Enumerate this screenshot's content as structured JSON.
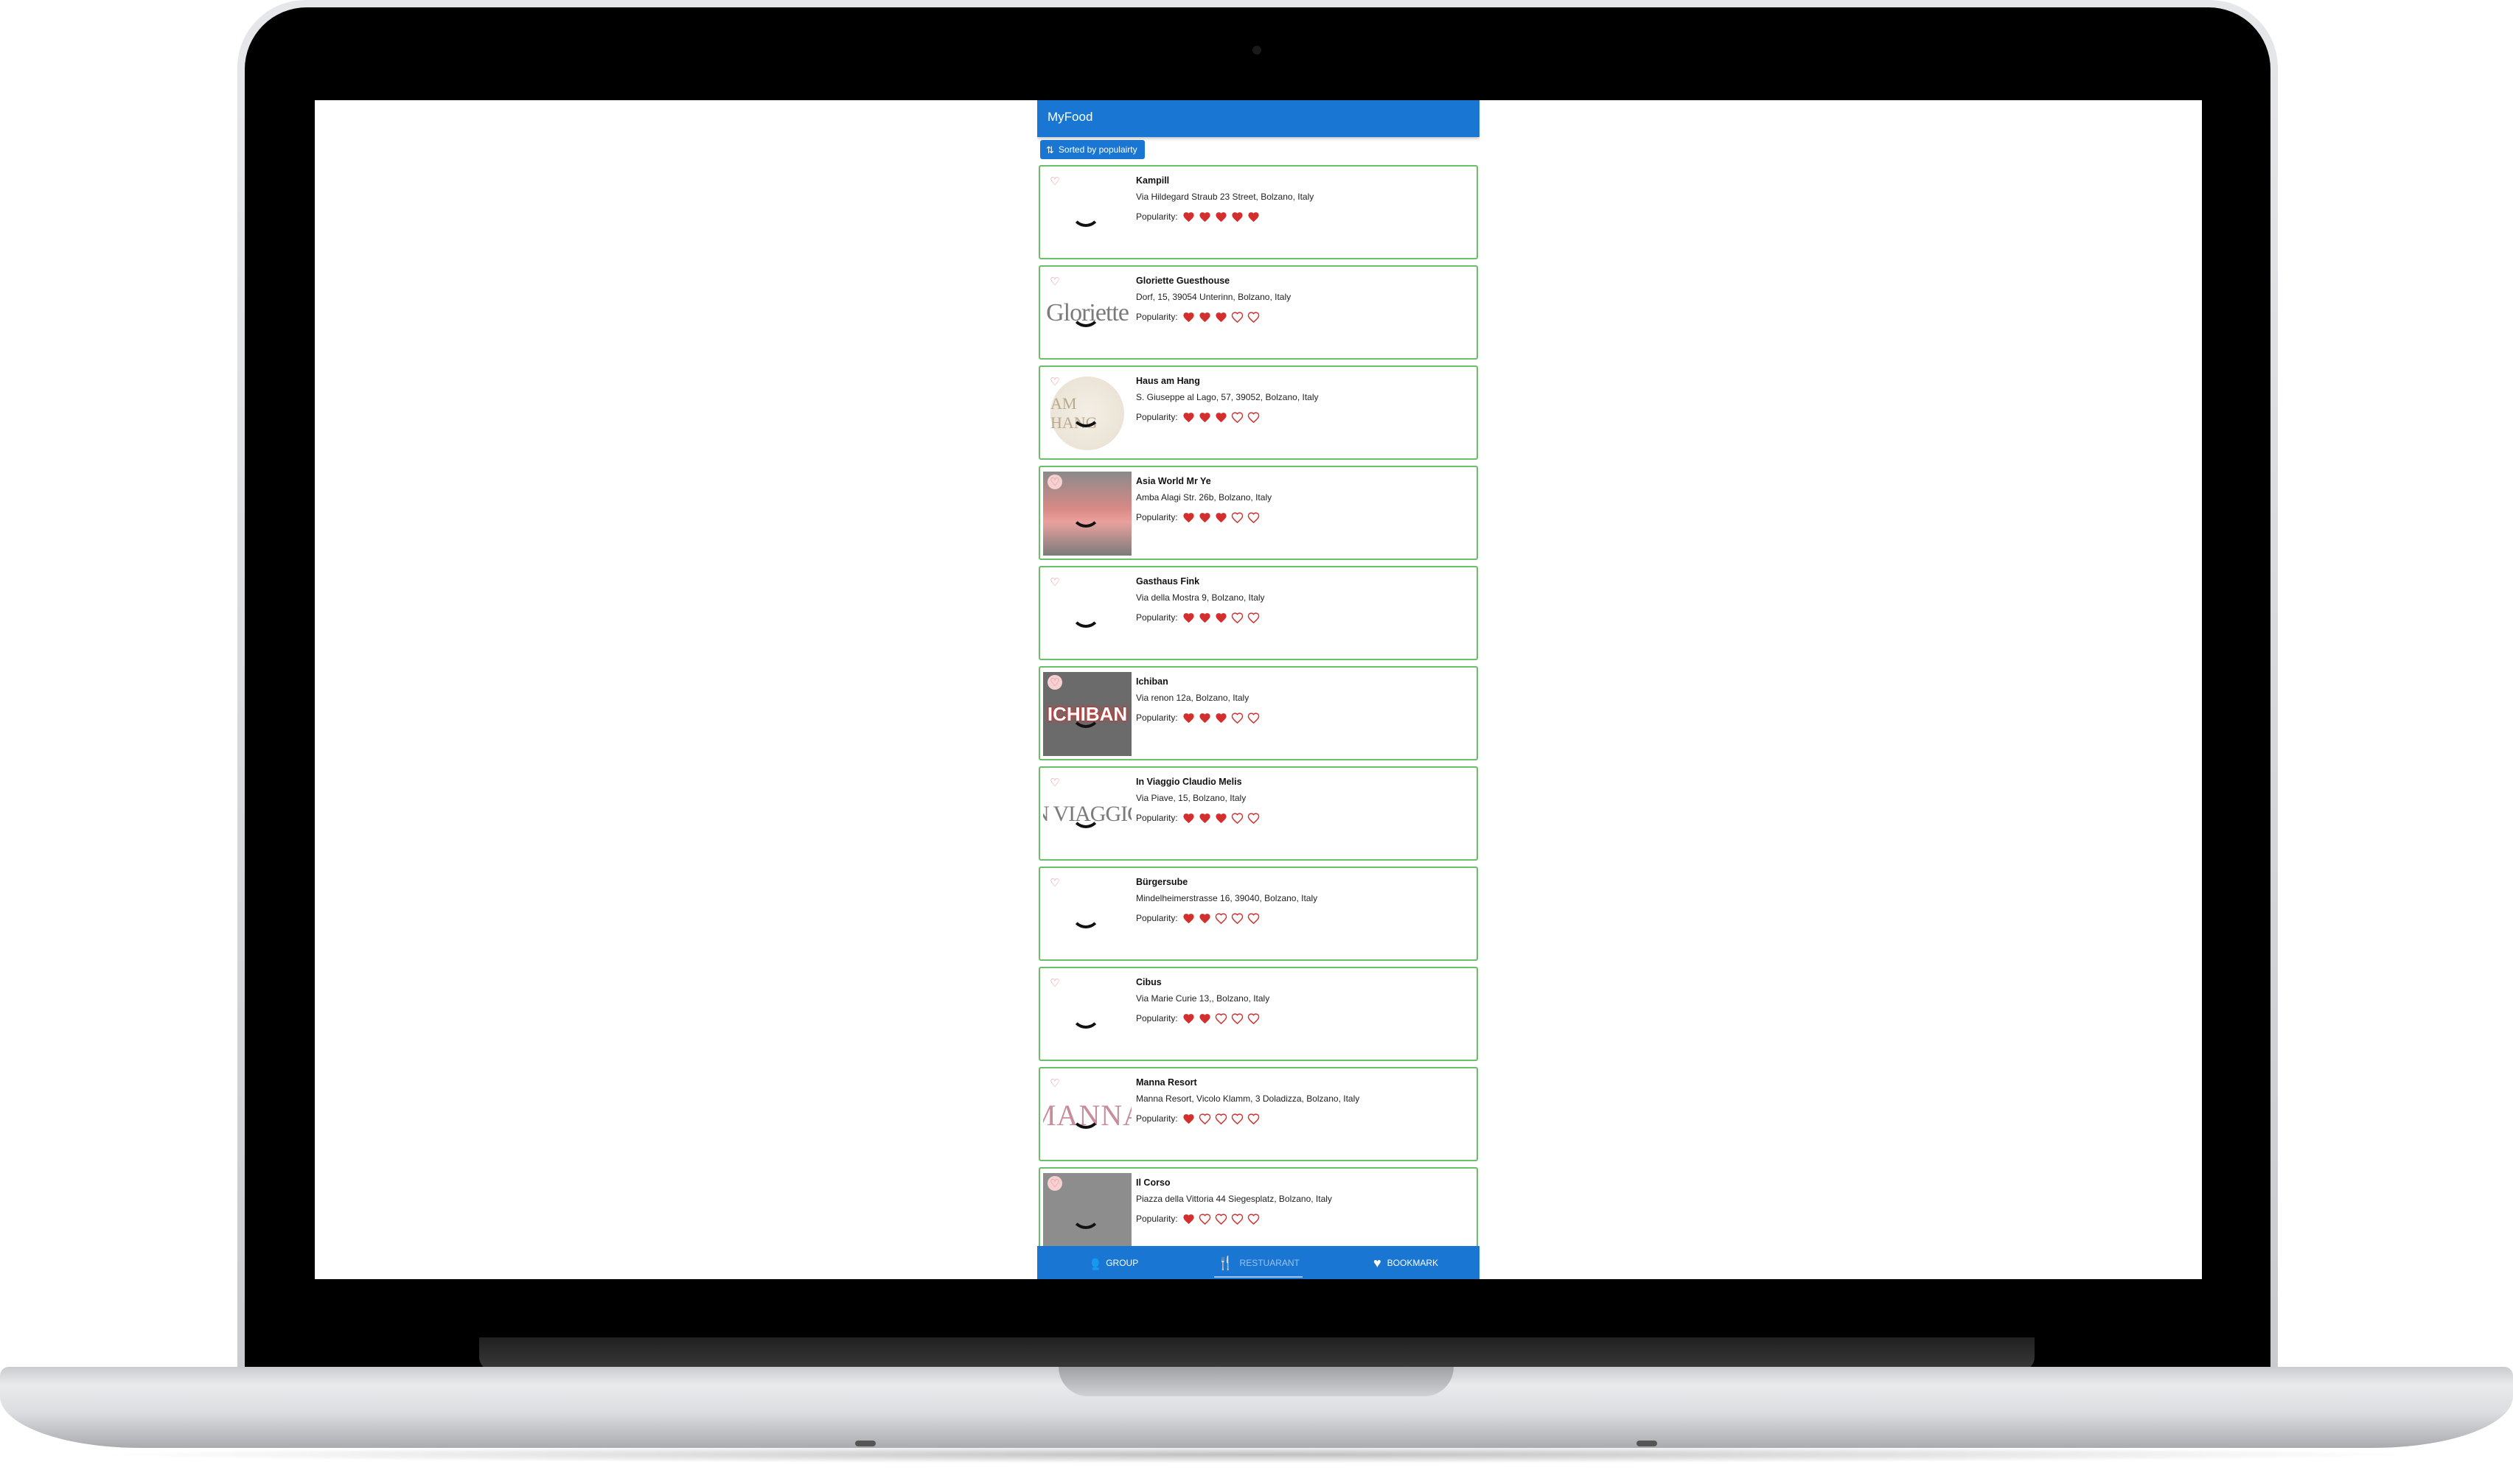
{
  "app": {
    "title": "MyFood",
    "sort_label": "Sorted by populairty",
    "popularity_label": "Popularity:",
    "colors": {
      "primary": "#1976d2",
      "card_border": "#6abf69",
      "heart": "#d32f2f"
    }
  },
  "restaurants": [
    {
      "name": "Kampill",
      "address": "Via Hildegard Straub 23 Street, Bolzano, Italy",
      "popularity": 5,
      "image": "none"
    },
    {
      "name": "Gloriette Guesthouse",
      "address": "Dorf, 15, 39054 Unterinn, Bolzano, Italy",
      "popularity": 3,
      "image": "gloriette-logo",
      "image_text": "Gloriette"
    },
    {
      "name": "Haus am Hang",
      "address": "S. Giuseppe al Lago, 57, 39052, Bolzano, Italy",
      "popularity": 3,
      "image": "round-logo",
      "image_text": "AM HANG"
    },
    {
      "name": "Asia World Mr Ye",
      "address": "Amba Alagi Str. 26b, Bolzano, Italy",
      "popularity": 3,
      "image": "pink-storefront"
    },
    {
      "name": "Gasthaus Fink",
      "address": "Via della Mostra 9, Bolzano, Italy",
      "popularity": 3,
      "image": "none"
    },
    {
      "name": "Ichiban",
      "address": "Via renon 12a, Bolzano, Italy",
      "popularity": 3,
      "image": "red-logo",
      "image_text": "ICHIBAN"
    },
    {
      "name": "In Viaggio Claudio Melis",
      "address": "Via Piave, 15, Bolzano, Italy",
      "popularity": 3,
      "image": "text-logo",
      "image_text": "N VIAGGIC"
    },
    {
      "name": "Bürgersube",
      "address": "Mindelheimerstrasse 16, 39040, Bolzano, Italy",
      "popularity": 2,
      "image": "none"
    },
    {
      "name": "Cibus",
      "address": "Via Marie Curie 13,, Bolzano, Italy",
      "popularity": 2,
      "image": "none"
    },
    {
      "name": "Manna Resort",
      "address": "Manna Resort, Vicolo Klamm, 3 Doladizza, Bolzano, Italy",
      "popularity": 1,
      "image": "manna-logo",
      "image_text": "MANNA"
    },
    {
      "name": "Il Corso",
      "address": "Piazza della Vittoria 44 Siegesplatz, Bolzano, Italy",
      "popularity": 1,
      "image": "grey-photo"
    }
  ],
  "bottom_nav": [
    {
      "label": "GROUP",
      "icon": "group-icon",
      "active": true
    },
    {
      "label": "RESTUARANT",
      "icon": "restaurant-icon",
      "active": false
    },
    {
      "label": "BOOKMARK",
      "icon": "heart-icon",
      "active": true
    }
  ]
}
